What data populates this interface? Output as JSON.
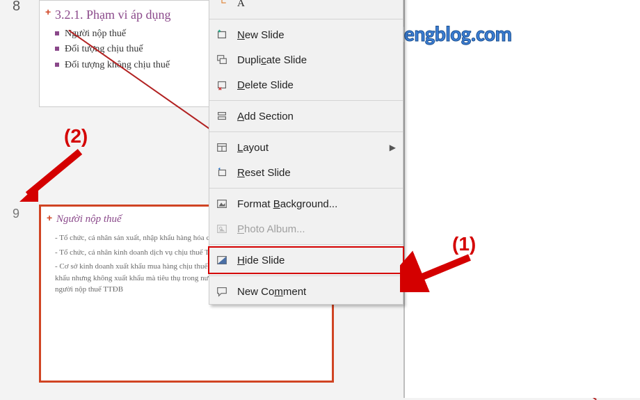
{
  "watermark": "Mechanicalengblog.com",
  "slide8": {
    "number": "8",
    "title": "3.2.1. Phạm vi áp dụng",
    "bullets": [
      "Người nộp thuế",
      "Đối tượng chịu thuế",
      "Đối tượng không chịu thuế"
    ]
  },
  "slide9": {
    "number": "9",
    "title": "Người nộp thuế",
    "body1": "- Tổ chức, cá nhân sản xuất, nhập khẩu hàng hóa chịu thuế TTĐB",
    "body2": "- Tổ chức, cá nhân kinh doanh dịch vụ chịu thuế TTĐB",
    "body3": "- Cơ sở kinh doanh xuất khẩu mua hàng chịu thuế TTĐB của cơ sở sản xuất để xuất khẩu nhưng không xuất khẩu mà tiêu thụ trong nước: cơ sở kinh doanh xuất khẩu là người nộp thuế TTĐB"
  },
  "menu": {
    "fontPreview": "A",
    "newSlide": "New Slide",
    "duplicateSlide": "Duplicate Slide",
    "deleteSlide": "Delete Slide",
    "addSection": "Add Section",
    "layout": "Layout",
    "resetSlide": "Reset Slide",
    "formatBackground": "Format Background...",
    "photoAlbum": "Photo Album...",
    "hideSlide": "Hide Slide",
    "newComment": "New Comment"
  },
  "annotations": {
    "one": "(1)",
    "two": "(2)"
  }
}
